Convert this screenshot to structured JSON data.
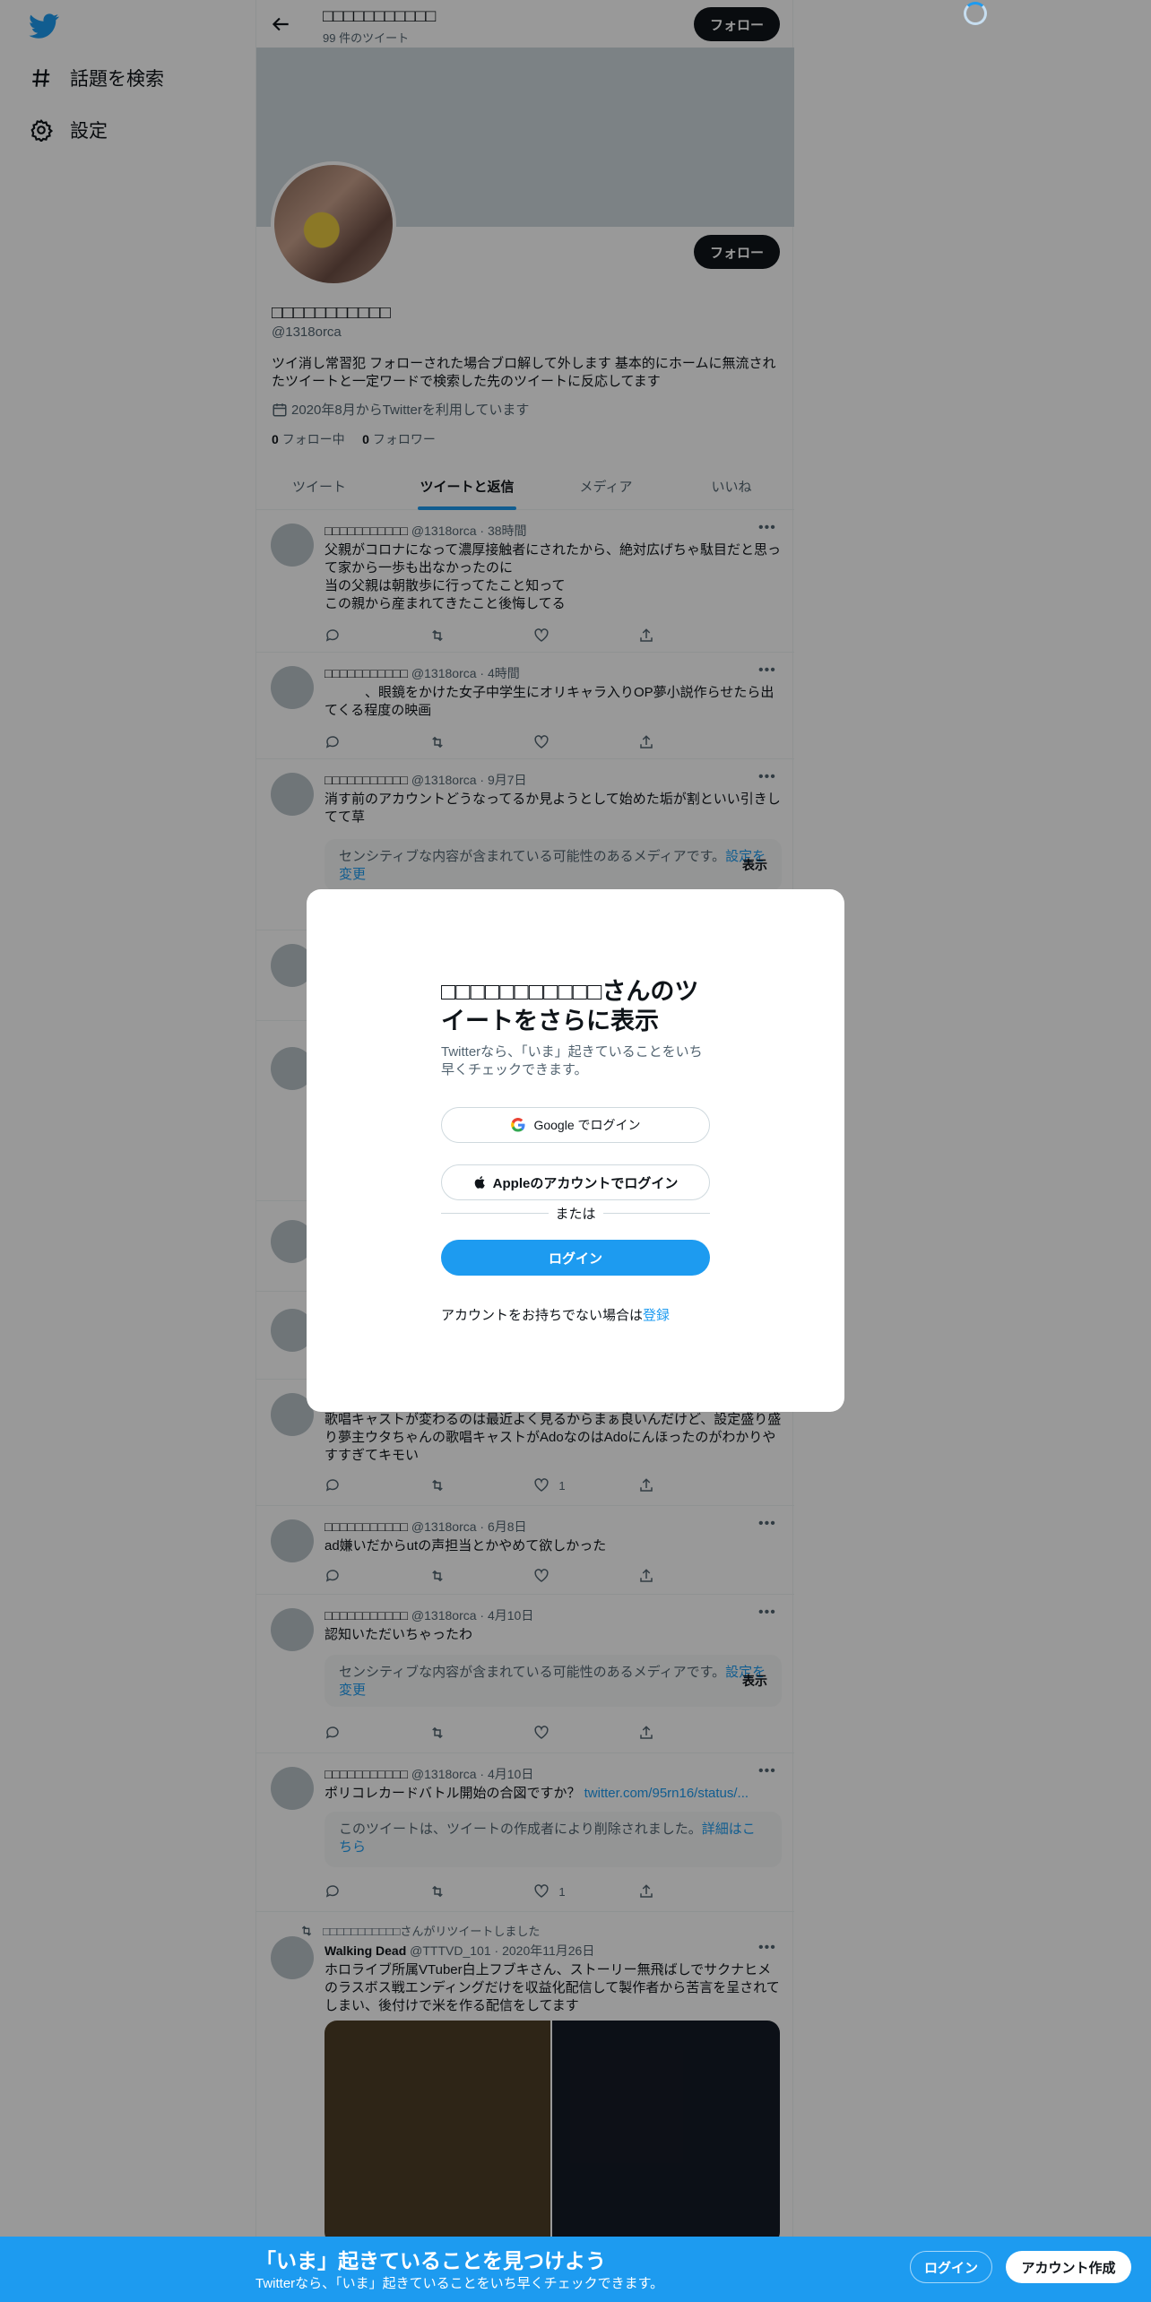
{
  "sidebar": {
    "explore_label": "話題を検索",
    "settings_label": "設定"
  },
  "topbar": {
    "title": "□□□□□□□□□□□",
    "tweet_count": "99 件のツイート",
    "follow_label": "フォロー"
  },
  "profile": {
    "follow_label": "フォロー",
    "name": "□□□□□□□□□□□",
    "handle": "@1318orca",
    "bio": "ツイ消し常習犯 フォローされた場合ブロ解して外します 基本的にホームに無流されたツイートと一定ワードで検索した先のツイートに反応してます",
    "joined": "2020年8月からTwitterを利用しています",
    "following_count": "0",
    "following_label": "フォロー中",
    "followers_count": "0",
    "followers_label": "フォロワー"
  },
  "tabs": [
    "ツイート",
    "ツイートと返信",
    "メディア",
    "いいね"
  ],
  "tweets": [
    {
      "name": "□□□□□□□□□□□",
      "handle": "@1318orca",
      "time": "38時間",
      "text": "父親がコロナになって濃厚接触者にされたから、絶対広げちゃ駄目だと思って家から一歩も出なかったのに\n当の父親は朝散歩に行ってたこと知って\nこの親から産まれてきたこと後悔してる",
      "likes": ""
    },
    {
      "name": "□□□□□□□□□□□",
      "handle": "@1318orca",
      "time": "4時間",
      "text": "　　　、眼鏡をかけた女子中学生にオリキャラ入りOP夢小説作らせたら出てくる程度の映画",
      "likes": ""
    },
    {
      "name": "□□□□□□□□□□□",
      "handle": "@1318orca",
      "time": "9月7日",
      "text": "消す前のアカウントどうなってるか見ようとして始めた垢が割といい引きしてて草"
    },
    {
      "text": "歌唱キャストが変わるのは最近よく見るからまぁ良いんだけど、設定盛り盛り夢主ウタちゃんの歌唱キャストがAdoなのはAdoにんほったのがわかりやすすぎてキモい",
      "likes": "1"
    },
    {
      "name": "□□□□□□□□□□□",
      "handle": "@1318orca",
      "time": "6月8日",
      "text": "ad嫌いだからutの声担当とかやめて欲しかった",
      "likes": ""
    },
    {
      "name": "□□□□□□□□□□□",
      "handle": "@1318orca",
      "time": "4月10日",
      "text": "認知いただいちゃったわ",
      "likes": ""
    },
    {
      "name": "□□□□□□□□□□□",
      "handle": "@1318orca",
      "time": "4月10日",
      "text": "ポリコレカードバトル開始の合図ですか？",
      "link": "twitter.com/95rn16/status/...",
      "likes": "1"
    },
    {
      "retweet_label": "□□□□□□□□□□□さんがリツイートしました",
      "name": "Walking Dead",
      "handle": "@TTTVD_101",
      "time": "2020年11月26日",
      "text": "ホロライブ所属VTuber白上フブキさん、ストーリー無飛ばしでサクナヒメのラスボス戦エンディングだけを収益化配信して製作者から苦言を呈されてしまい、後付けで米を作る配信をしてます"
    }
  ],
  "sensitive": {
    "text": "センシティブな内容が含まれている可能性のあるメディアです。",
    "link": "設定を変更",
    "show": "表示"
  },
  "deleted": {
    "text": "このツイートは、ツイートの作成者により削除されました。",
    "link": "詳細はこちら"
  },
  "modal": {
    "title_name": "□□□□□□□□□□□",
    "title_rest": "さんのツイートをさらに表示",
    "subtitle": "Twitterなら、「いま」起きていることをいち早くチェックできます。",
    "google_label": "Google でログイン",
    "apple_label": "Appleのアカウントでログイン",
    "or_label": "または",
    "login_label": "ログイン",
    "signup_prefix": "アカウントをお持ちでない場合は",
    "signup_link": "登録"
  },
  "bottombar": {
    "title": "「いま」起きていることを見つけよう",
    "subtitle": "Twitterなら、「いま」起きていることをいち早くチェックできます。",
    "login_label": "ログイン",
    "signup_label": "アカウント作成"
  },
  "colors": {
    "accent": "#1d9bf0",
    "text": "#0f1419",
    "secondary": "#536471"
  }
}
